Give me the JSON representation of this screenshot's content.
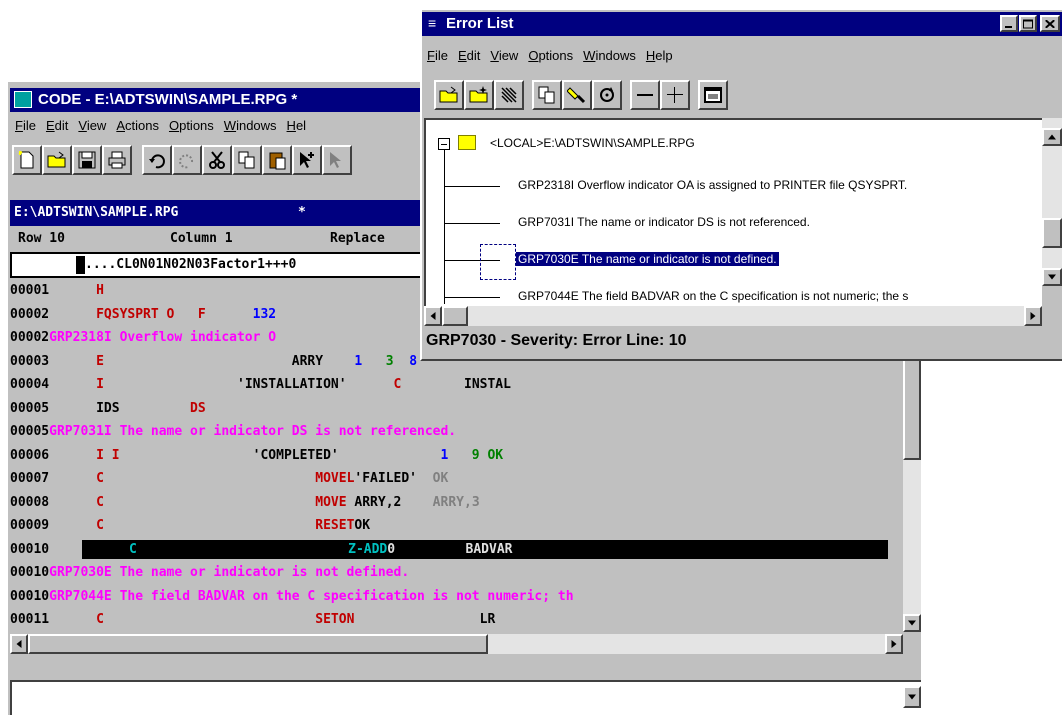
{
  "code_window": {
    "title": "CODE - E:\\ADTSWIN\\SAMPLE.RPG  *",
    "menu": [
      "File",
      "Edit",
      "View",
      "Actions",
      "Options",
      "Windows",
      "Hel"
    ],
    "doc_title": "E:\\ADTSWIN\\SAMPLE.RPG",
    "doc_modified": "*",
    "status": {
      "row": "Row 10",
      "column": "Column 1",
      "mode": "Replace"
    },
    "ruler": "....CL0N01N02N03Factor1+++0",
    "lines": [
      {
        "num": "00001",
        "parts": [
          {
            "t": "      H",
            "c": "red"
          }
        ]
      },
      {
        "num": "00002",
        "parts": [
          {
            "t": "      FQSYSPRT ",
            "c": "red"
          },
          {
            "t": "O",
            "c": "red"
          },
          {
            "t": "   F",
            "c": "red"
          },
          {
            "t": "      132",
            "c": "blu"
          }
        ]
      },
      {
        "num": "00002",
        "parts": [
          {
            "t": "GRP2318I Overflow indicator O",
            "c": "mag"
          }
        ]
      },
      {
        "num": "00003",
        "parts": [
          {
            "t": "      E",
            "c": "red"
          },
          {
            "t": "                        ARRY",
            "c": "blk"
          },
          {
            "t": "    1",
            "c": "blu"
          },
          {
            "t": "   3",
            "c": "grn"
          },
          {
            "t": "  8",
            "c": "blu"
          }
        ]
      },
      {
        "num": "00004",
        "parts": [
          {
            "t": "      I",
            "c": "red"
          },
          {
            "t": "                 'INSTALLATION'",
            "c": "blk"
          },
          {
            "t": "      C",
            "c": "red"
          },
          {
            "t": "        INSTAL",
            "c": "blk"
          }
        ]
      },
      {
        "num": "00005",
        "parts": [
          {
            "t": "      IDS",
            "c": "blk"
          },
          {
            "t": "         DS",
            "c": "red"
          }
        ]
      },
      {
        "num": "00005",
        "parts": [
          {
            "t": "GRP7031I The name or indicator DS is not referenced.",
            "c": "mag"
          }
        ]
      },
      {
        "num": "00006",
        "parts": [
          {
            "t": "      I I",
            "c": "red"
          },
          {
            "t": "                 'COMPLETED'",
            "c": "blk"
          },
          {
            "t": "             1",
            "c": "blu"
          },
          {
            "t": "   9 OK",
            "c": "grn"
          }
        ]
      },
      {
        "num": "00007",
        "parts": [
          {
            "t": "      C",
            "c": "red"
          },
          {
            "t": "                           MOVEL",
            "c": "red"
          },
          {
            "t": "'FAILED'",
            "c": "blk"
          },
          {
            "t": "  OK",
            "c": "gry"
          }
        ]
      },
      {
        "num": "00008",
        "parts": [
          {
            "t": "      C",
            "c": "red"
          },
          {
            "t": "                           MOVE",
            "c": "red"
          },
          {
            "t": " ARRY,2",
            "c": "blk"
          },
          {
            "t": "    ARRY,3",
            "c": "gry"
          }
        ]
      },
      {
        "num": "00009",
        "parts": [
          {
            "t": "      C",
            "c": "red"
          },
          {
            "t": "                           RESET",
            "c": "red"
          },
          {
            "t": "OK",
            "c": "blk"
          }
        ]
      },
      {
        "num": "00010",
        "selected": true,
        "parts": [
          {
            "t": "      C",
            "c": "cyn"
          },
          {
            "t": "                           Z-ADD",
            "c": "cyn"
          },
          {
            "t": "0",
            "c": "wht"
          },
          {
            "t": "         BADVAR",
            "c": "wht"
          }
        ]
      },
      {
        "num": "00010",
        "parts": [
          {
            "t": "GRP7030E The name or indicator is not defined.",
            "c": "mag"
          }
        ]
      },
      {
        "num": "00010",
        "parts": [
          {
            "t": "GRP7044E The field BADVAR on the C specification is not numeric; th",
            "c": "mag"
          }
        ]
      },
      {
        "num": "00011",
        "parts": [
          {
            "t": "      C",
            "c": "red"
          },
          {
            "t": "                           SETON",
            "c": "red"
          },
          {
            "t": "                LR",
            "c": "blk"
          }
        ]
      }
    ]
  },
  "error_window": {
    "title": "Error List",
    "menu": [
      "File",
      "Edit",
      "View",
      "Options",
      "Windows",
      "Help"
    ],
    "root": "<LOCAL>E:\\ADTSWIN\\SAMPLE.RPG",
    "items": [
      "GRP2318I Overflow indicator OA is assigned to PRINTER file QSYSPRT.",
      "GRP7031I The name or indicator DS is not referenced.",
      "GRP7030E The name or indicator is not defined.",
      "GRP7044E The field BADVAR on the C specification is not numeric; the s"
    ],
    "status": "GRP7030 - Severity: Error  Line: 10"
  },
  "colors": {
    "titlebar": "#000080",
    "selection": "#000080",
    "error_text": "#ff00ff",
    "spec_text": "#c00000"
  }
}
